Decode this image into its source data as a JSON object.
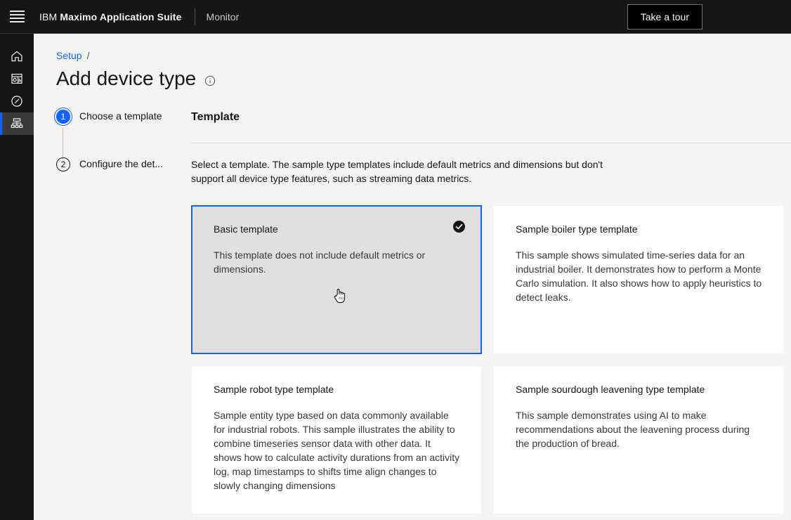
{
  "header": {
    "menu_icon": "hamburger-menu-icon",
    "brand_prefix": "IBM",
    "brand_name": "Maximo Application Suite",
    "subtitle": "Monitor",
    "take_tour_label": "Take a tour"
  },
  "left_rail": {
    "items": [
      {
        "name": "home",
        "icon": "home-icon"
      },
      {
        "name": "dashboard",
        "icon": "dashboard-icon"
      },
      {
        "name": "explore",
        "icon": "compass-icon"
      },
      {
        "name": "device-types",
        "icon": "hierarchy-icon",
        "active": true
      }
    ]
  },
  "breadcrumb": {
    "link_label": "Setup",
    "separator": "/"
  },
  "page": {
    "title": "Add device type",
    "info_icon": "information-icon"
  },
  "steps": [
    {
      "number": "1",
      "label": "Choose a template",
      "state": "current"
    },
    {
      "number": "2",
      "label": "Configure the det...",
      "state": "upcoming"
    }
  ],
  "template_panel": {
    "heading": "Template",
    "description": "Select a template. The sample type templates include default metrics and dimensions but don't support all device type features, such as streaming data metrics."
  },
  "cards": [
    {
      "title": "Basic template",
      "description": "This template does not include default metrics or dimensions.",
      "selected": true,
      "check_icon": "checkmark-filled-icon"
    },
    {
      "title": "Sample boiler type template",
      "description": "This sample shows simulated time-series data for an industrial boiler. It demonstrates how to perform a Monte Carlo simulation. It also shows how to apply heuristics to detect leaks.",
      "selected": false
    },
    {
      "title": "Sample robot type template",
      "description": "Sample entity type based on data commonly available for industrial robots. This sample illustrates the ability to combine timeseries sensor data with other data. It shows how to calculate activity durations from an activity log, map timestamps to shifts time align changes to slowly changing dimensions",
      "selected": false
    },
    {
      "title": "Sample sourdough leavening type template",
      "description": "This sample demonstrates using AI to make recommendations about the leavening process during the production of bread.",
      "selected": false
    }
  ],
  "cursor": {
    "icon": "pointer-hand-cursor"
  },
  "colors": {
    "header_bg": "#161616",
    "accent_blue": "#0f62fe",
    "page_bg": "#f4f4f4",
    "card_bg": "#ffffff",
    "selected_card_bg": "#e0e0e0"
  }
}
